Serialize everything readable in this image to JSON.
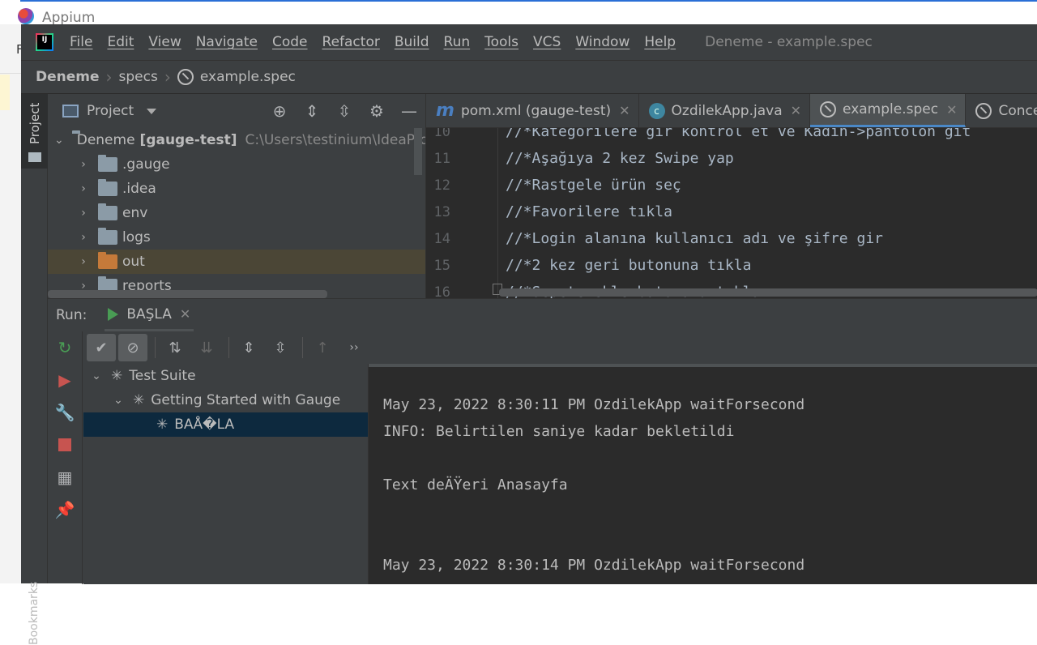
{
  "background": {
    "app_title": "Appium",
    "side_letter": "F"
  },
  "menubar": {
    "logo": "IJ",
    "items": [
      "File",
      "Edit",
      "View",
      "Navigate",
      "Code",
      "Refactor",
      "Build",
      "Run",
      "Tools",
      "VCS",
      "Window",
      "Help"
    ],
    "window_title": "Deneme - example.spec"
  },
  "breadcrumb": {
    "project": "Deneme",
    "folder": "specs",
    "file": "example.spec"
  },
  "left_stripe": {
    "project_label": "Project",
    "bookmarks_label": "Bookmarks"
  },
  "project_panel": {
    "title": "Project",
    "root_name": "Deneme",
    "root_module": "[gauge-test]",
    "root_path": "C:\\Users\\testinium\\IdeaPro",
    "folders": [
      ".gauge",
      ".idea",
      "env",
      "logs",
      "out",
      "reports"
    ]
  },
  "editor": {
    "tabs": [
      {
        "label": "pom.xml (gauge-test)",
        "icon": "maven-icon"
      },
      {
        "label": "OzdilekApp.java",
        "icon": "class-icon"
      },
      {
        "label": "example.spec",
        "icon": "spec-icon"
      },
      {
        "label": "Concept.cp",
        "icon": "spec-icon"
      }
    ],
    "lines": [
      {
        "num": "10",
        "text": "//*Kategorilere gir kontrol et ve Kadın->pantolon git"
      },
      {
        "num": "11",
        "text": "//*Aşağıya 2 kez Swipe yap"
      },
      {
        "num": "12",
        "text": "//*Rastgele ürün seç"
      },
      {
        "num": "13",
        "text": "//*Favorilere tıkla"
      },
      {
        "num": "14",
        "text": "//*Login alanına kullanıcı adı ve şifre gir"
      },
      {
        "num": "15",
        "text": "//*2 kez geri butonuna tıkla"
      },
      {
        "num": "16",
        "text": "//*Sepete ekle butonuna tıkla"
      }
    ]
  },
  "run_panel": {
    "label": "Run:",
    "tab": "BAŞLA",
    "tree": {
      "suite": "Test Suite",
      "spec": "Getting Started with Gauge",
      "scenario": "BAÅ�LA"
    },
    "console": [
      "May 23, 2022 8:30:11 PM OzdilekApp waitForsecond",
      "INFO: Belirtilen saniye kadar bekletildi",
      "",
      "Text deÄŸeri Anasayfa",
      "",
      "",
      "May 23, 2022 8:30:14 PM OzdilekApp waitForsecond"
    ]
  }
}
